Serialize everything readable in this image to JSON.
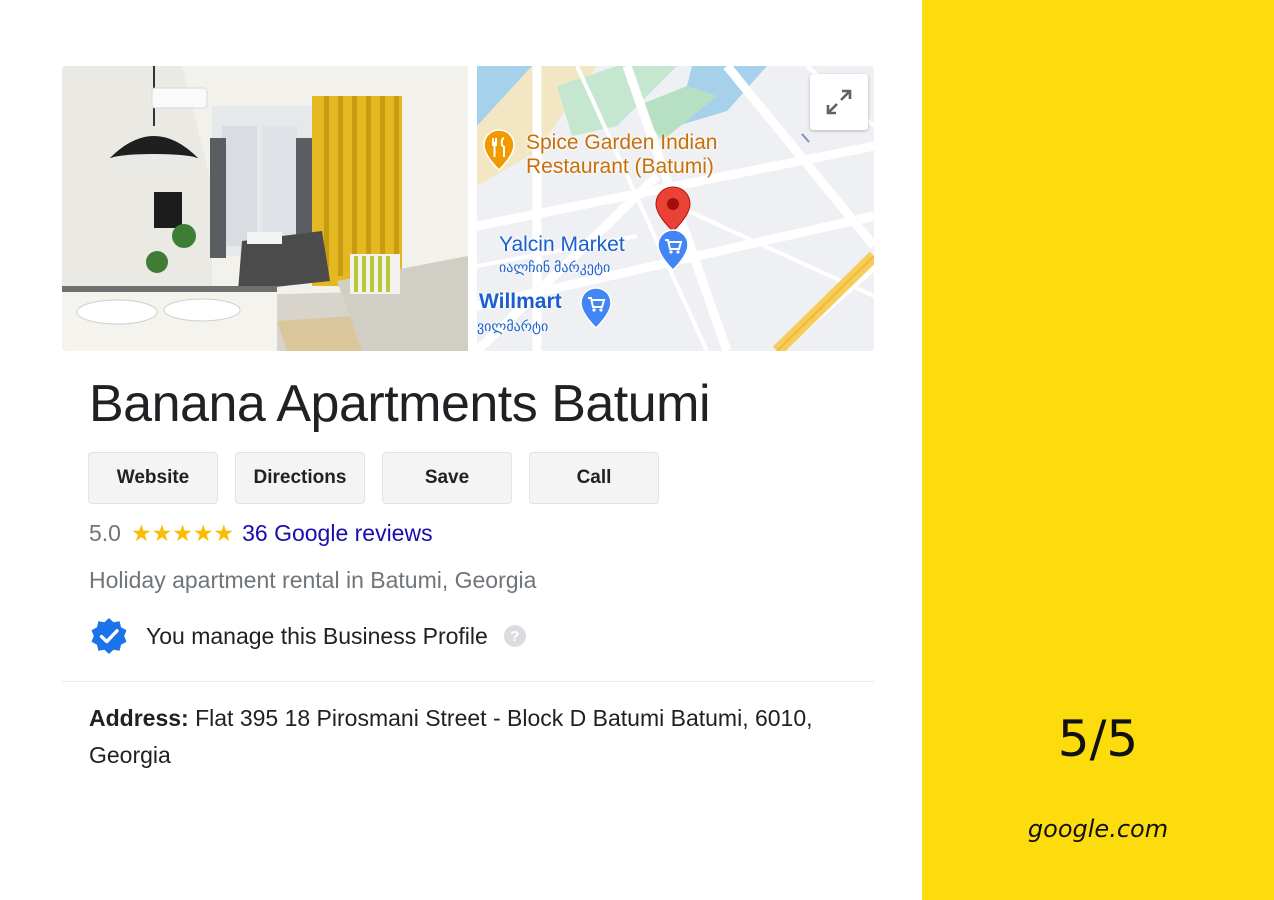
{
  "business": {
    "name": "Banana Apartments Batumi",
    "rating": "5.0",
    "stars": "★★★★★",
    "reviews_link": "36 Google reviews",
    "category": "Holiday apartment rental in Batumi, Georgia",
    "manage_text": "You manage this Business Profile",
    "help_glyph": "?",
    "address_label": "Address:",
    "address_value": " Flat 395 18 Pirosmani Street - Block D Batumi Batumi, 6010, Georgia"
  },
  "actions": {
    "website": "Website",
    "directions": "Directions",
    "save": "Save",
    "call": "Call"
  },
  "map": {
    "poi_1_line1": "Spice Garden Indian",
    "poi_1_line2": "Restaurant (Batumi)",
    "poi_2": "Yalcin Market",
    "poi_2_local": "იალჩინ მარკეტი",
    "poi_3": "Willmart",
    "poi_3_local": "ვილმარტი"
  },
  "side_panel": {
    "score": "5/5",
    "source": "google.com"
  },
  "colors": {
    "accent_yellow": "#fddc0e",
    "link_blue": "#1a0dab",
    "star_gold": "#fbbc04",
    "verified_blue": "#1a73e8"
  }
}
